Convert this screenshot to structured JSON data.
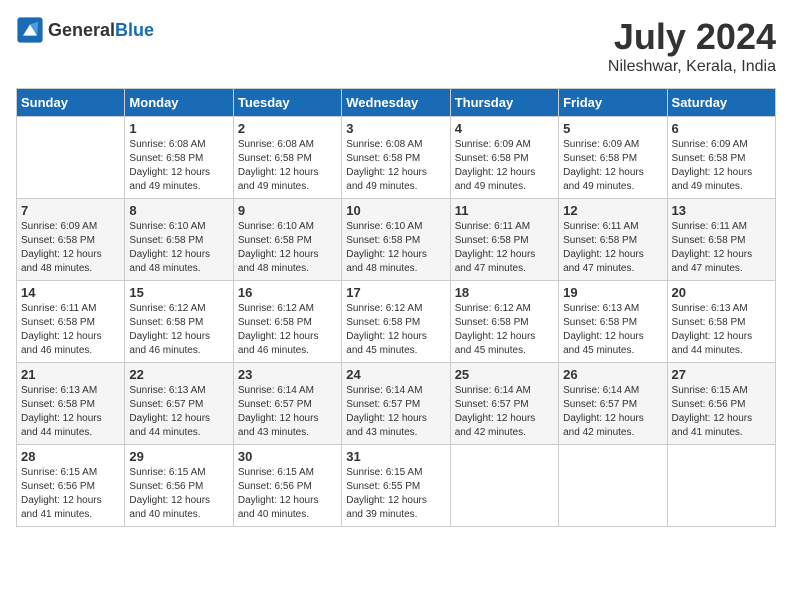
{
  "header": {
    "logo_general": "General",
    "logo_blue": "Blue",
    "title": "July 2024",
    "subtitle": "Nileshwar, Kerala, India"
  },
  "weekdays": [
    "Sunday",
    "Monday",
    "Tuesday",
    "Wednesday",
    "Thursday",
    "Friday",
    "Saturday"
  ],
  "weeks": [
    [
      {
        "day": "",
        "sunrise": "",
        "sunset": "",
        "daylight": ""
      },
      {
        "day": "1",
        "sunrise": "6:08 AM",
        "sunset": "6:58 PM",
        "daylight": "12 hours and 49 minutes."
      },
      {
        "day": "2",
        "sunrise": "6:08 AM",
        "sunset": "6:58 PM",
        "daylight": "12 hours and 49 minutes."
      },
      {
        "day": "3",
        "sunrise": "6:08 AM",
        "sunset": "6:58 PM",
        "daylight": "12 hours and 49 minutes."
      },
      {
        "day": "4",
        "sunrise": "6:09 AM",
        "sunset": "6:58 PM",
        "daylight": "12 hours and 49 minutes."
      },
      {
        "day": "5",
        "sunrise": "6:09 AM",
        "sunset": "6:58 PM",
        "daylight": "12 hours and 49 minutes."
      },
      {
        "day": "6",
        "sunrise": "6:09 AM",
        "sunset": "6:58 PM",
        "daylight": "12 hours and 49 minutes."
      }
    ],
    [
      {
        "day": "7",
        "sunrise": "6:09 AM",
        "sunset": "6:58 PM",
        "daylight": "12 hours and 48 minutes."
      },
      {
        "day": "8",
        "sunrise": "6:10 AM",
        "sunset": "6:58 PM",
        "daylight": "12 hours and 48 minutes."
      },
      {
        "day": "9",
        "sunrise": "6:10 AM",
        "sunset": "6:58 PM",
        "daylight": "12 hours and 48 minutes."
      },
      {
        "day": "10",
        "sunrise": "6:10 AM",
        "sunset": "6:58 PM",
        "daylight": "12 hours and 48 minutes."
      },
      {
        "day": "11",
        "sunrise": "6:11 AM",
        "sunset": "6:58 PM",
        "daylight": "12 hours and 47 minutes."
      },
      {
        "day": "12",
        "sunrise": "6:11 AM",
        "sunset": "6:58 PM",
        "daylight": "12 hours and 47 minutes."
      },
      {
        "day": "13",
        "sunrise": "6:11 AM",
        "sunset": "6:58 PM",
        "daylight": "12 hours and 47 minutes."
      }
    ],
    [
      {
        "day": "14",
        "sunrise": "6:11 AM",
        "sunset": "6:58 PM",
        "daylight": "12 hours and 46 minutes."
      },
      {
        "day": "15",
        "sunrise": "6:12 AM",
        "sunset": "6:58 PM",
        "daylight": "12 hours and 46 minutes."
      },
      {
        "day": "16",
        "sunrise": "6:12 AM",
        "sunset": "6:58 PM",
        "daylight": "12 hours and 46 minutes."
      },
      {
        "day": "17",
        "sunrise": "6:12 AM",
        "sunset": "6:58 PM",
        "daylight": "12 hours and 45 minutes."
      },
      {
        "day": "18",
        "sunrise": "6:12 AM",
        "sunset": "6:58 PM",
        "daylight": "12 hours and 45 minutes."
      },
      {
        "day": "19",
        "sunrise": "6:13 AM",
        "sunset": "6:58 PM",
        "daylight": "12 hours and 45 minutes."
      },
      {
        "day": "20",
        "sunrise": "6:13 AM",
        "sunset": "6:58 PM",
        "daylight": "12 hours and 44 minutes."
      }
    ],
    [
      {
        "day": "21",
        "sunrise": "6:13 AM",
        "sunset": "6:58 PM",
        "daylight": "12 hours and 44 minutes."
      },
      {
        "day": "22",
        "sunrise": "6:13 AM",
        "sunset": "6:57 PM",
        "daylight": "12 hours and 44 minutes."
      },
      {
        "day": "23",
        "sunrise": "6:14 AM",
        "sunset": "6:57 PM",
        "daylight": "12 hours and 43 minutes."
      },
      {
        "day": "24",
        "sunrise": "6:14 AM",
        "sunset": "6:57 PM",
        "daylight": "12 hours and 43 minutes."
      },
      {
        "day": "25",
        "sunrise": "6:14 AM",
        "sunset": "6:57 PM",
        "daylight": "12 hours and 42 minutes."
      },
      {
        "day": "26",
        "sunrise": "6:14 AM",
        "sunset": "6:57 PM",
        "daylight": "12 hours and 42 minutes."
      },
      {
        "day": "27",
        "sunrise": "6:15 AM",
        "sunset": "6:56 PM",
        "daylight": "12 hours and 41 minutes."
      }
    ],
    [
      {
        "day": "28",
        "sunrise": "6:15 AM",
        "sunset": "6:56 PM",
        "daylight": "12 hours and 41 minutes."
      },
      {
        "day": "29",
        "sunrise": "6:15 AM",
        "sunset": "6:56 PM",
        "daylight": "12 hours and 40 minutes."
      },
      {
        "day": "30",
        "sunrise": "6:15 AM",
        "sunset": "6:56 PM",
        "daylight": "12 hours and 40 minutes."
      },
      {
        "day": "31",
        "sunrise": "6:15 AM",
        "sunset": "6:55 PM",
        "daylight": "12 hours and 39 minutes."
      },
      {
        "day": "",
        "sunrise": "",
        "sunset": "",
        "daylight": ""
      },
      {
        "day": "",
        "sunrise": "",
        "sunset": "",
        "daylight": ""
      },
      {
        "day": "",
        "sunrise": "",
        "sunset": "",
        "daylight": ""
      }
    ]
  ]
}
